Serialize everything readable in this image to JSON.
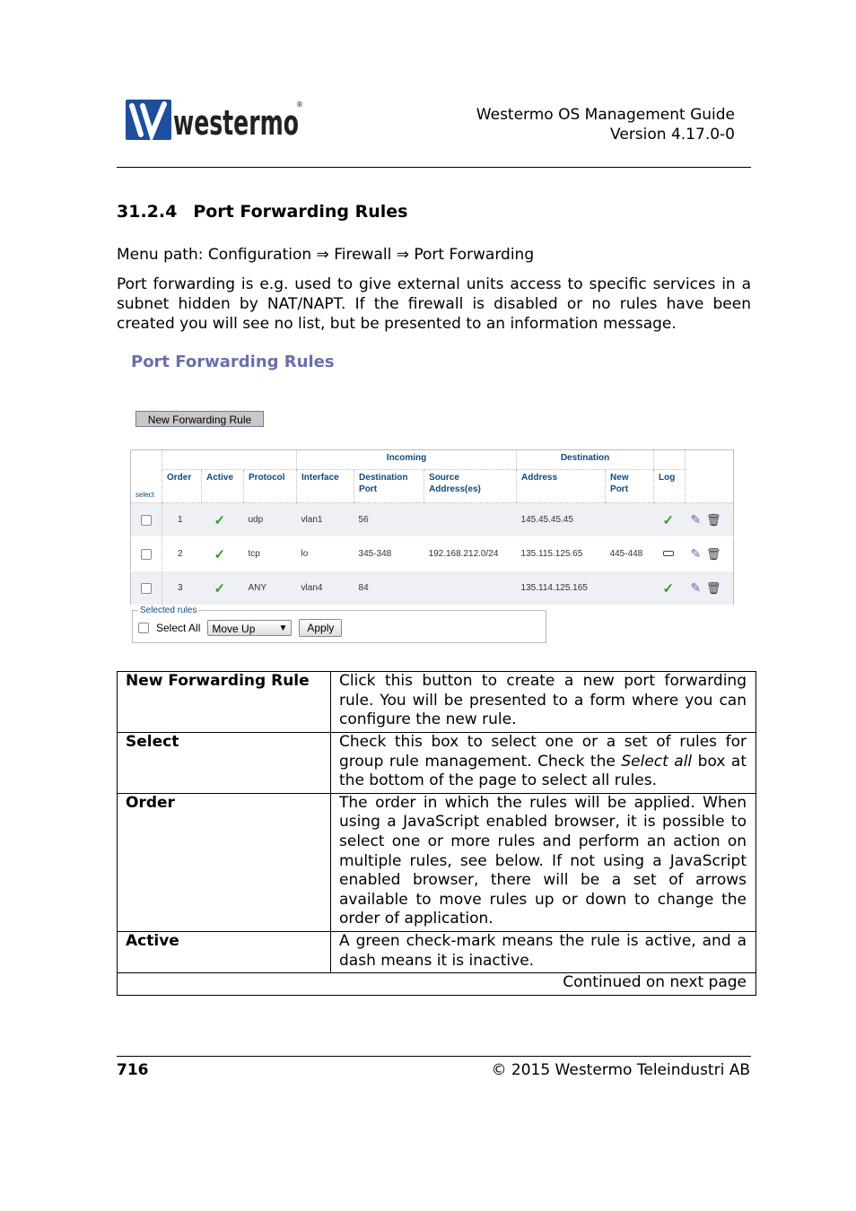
{
  "header": {
    "logo_text": "westermo",
    "brand_color": "#1d4f9c",
    "guide_title": "Westermo OS Management Guide",
    "version": "Version 4.17.0-0"
  },
  "section": {
    "number": "31.2.4",
    "title": "Port Forwarding Rules"
  },
  "menu_path": "Menu path: Configuration ⇒ Firewall ⇒ Port Forwarding",
  "intro": "Port forwarding is e.g.  used to give external units access to specific services in a subnet hidden by NAT/NAPT. If the firewall is disabled or no rules have been created you will see no list, but be presented to an information message.",
  "screenshot": {
    "title": "Port Forwarding Rules",
    "new_rule_button": "New Forwarding Rule",
    "group_headers": {
      "incoming": "Incoming",
      "destination": "Destination"
    },
    "columns": {
      "select": "select",
      "order": "Order",
      "active": "Active",
      "protocol": "Protocol",
      "interface": "Interface",
      "dest_port": "Destination Port",
      "source": "Source Address(es)",
      "address": "Address",
      "new_port": "New Port",
      "log": "Log"
    },
    "rows": [
      {
        "order": "1",
        "active": true,
        "protocol": "udp",
        "interface": "vlan1",
        "dest_port": "56",
        "source": "",
        "address": "145.45.45.45",
        "new_port": "",
        "log": true
      },
      {
        "order": "2",
        "active": true,
        "protocol": "tcp",
        "interface": "lo",
        "dest_port": "345-348",
        "source": "192.168.212.0/24",
        "address": "135.115.125.65",
        "new_port": "445-448",
        "log": false
      },
      {
        "order": "3",
        "active": true,
        "protocol": "ANY",
        "interface": "vlan4",
        "dest_port": "84",
        "source": "",
        "address": "135.114.125.165",
        "new_port": "",
        "log": true
      }
    ],
    "selected_rules": {
      "legend": "Selected rules",
      "select_all": "Select All",
      "action": "Move Up",
      "apply": "Apply"
    }
  },
  "desc_table": [
    {
      "term": "New Forwarding Rule",
      "desc": "Click this button to create a new port forwarding rule. You will be presented to a form where you can configure the new rule."
    },
    {
      "term": "Select",
      "desc_pre": "Check this box to select one or a set of rules for group rule management. Check the ",
      "desc_em": "Select all",
      "desc_post": " box at the bottom of the page to select all rules."
    },
    {
      "term": "Order",
      "desc": "The order in which the rules will be applied.  When using a JavaScript enabled browser, it is possible to select one or more rules and perform an action on multiple rules, see below.  If not using a JavaScript enabled browser, there will be a set of arrows available to move rules up or down to change the order of application."
    },
    {
      "term": "Active",
      "desc": "A green check-mark means the rule is active, and a dash means it is inactive."
    }
  ],
  "continued": "Continued on next page",
  "footer": {
    "page": "716",
    "copyright": "© 2015 Westermo Teleindustri AB"
  }
}
